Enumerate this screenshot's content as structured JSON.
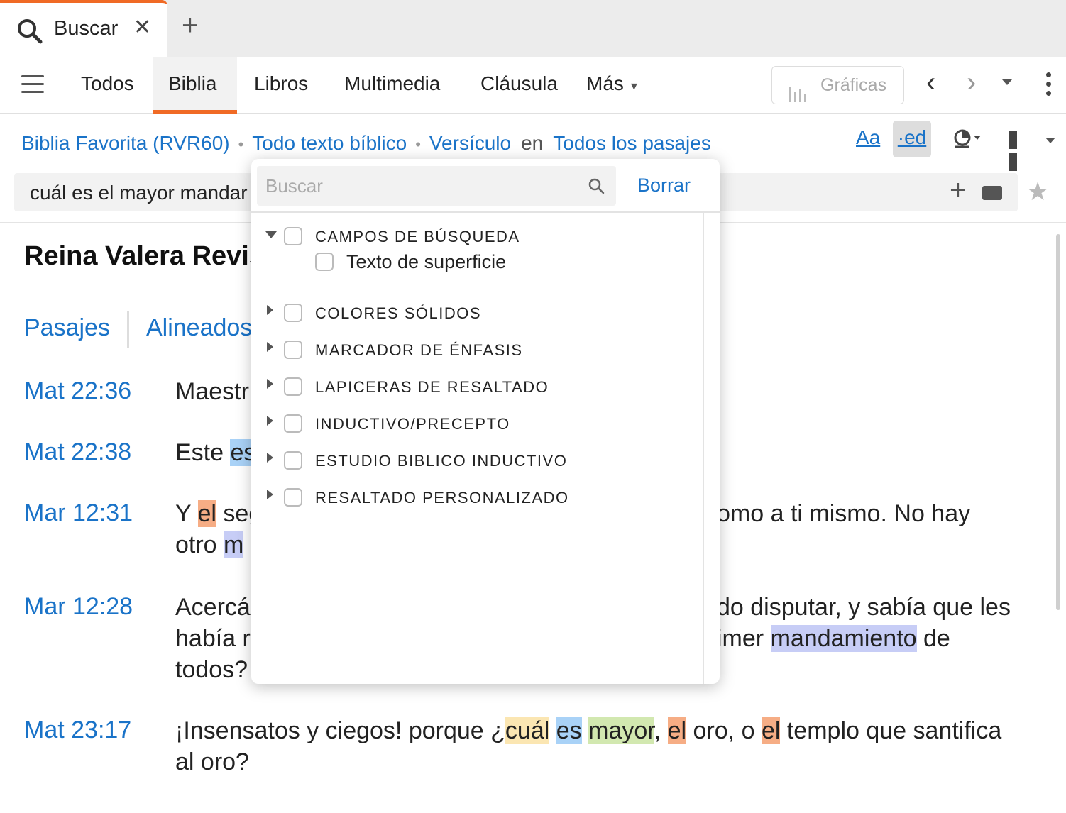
{
  "tab": {
    "title": "Buscar"
  },
  "nav": {
    "tabs": [
      "Todos",
      "Biblia",
      "Libros",
      "Multimedia",
      "Cláusula",
      "Más"
    ],
    "active_tab": "Biblia",
    "charts_label": "Gráficas"
  },
  "criteria": {
    "bible": "Biblia Favorita (RVR60)",
    "text": "Todo texto bíblico",
    "unit": "Versículo",
    "connector": "en",
    "range": "Todos los pasajes",
    "format_aa": "Aa",
    "format_ed": "·ed"
  },
  "search": {
    "query": "cuál es el mayor mandar"
  },
  "results": {
    "title": "Reina Valera Revis",
    "view_tabs": [
      "Pasajes",
      "Alineados"
    ],
    "verses": [
      {
        "ref": "Mat 22:36",
        "line1": "Maestr",
        "line2": ""
      },
      {
        "ref": "Mat 22:38",
        "pre": "Este ",
        "hl": "es"
      },
      {
        "ref": "Mar 12:31",
        "pre": "Y ",
        "hl": "el",
        "post": " seg",
        "right": "omo a ti mismo. No hay",
        "line2_pre": "otro ",
        "line2_hl": "m"
      },
      {
        "ref": "Mar 12:28",
        "pre": "Acercá",
        "right": "do disputar, y sabía que les",
        "line2_pre": "había r",
        "line2_right_pre": "imer ",
        "line2_right_hl": "mandamiento",
        "line2_right_post": " de",
        "line3": "todos?"
      },
      {
        "ref": "Mat 23:17",
        "t1": "¡Insensatos y ciegos! porque ¿",
        "h1": "cuál",
        "h2": "es",
        "h3": "mayor",
        "t2": ", ",
        "h4": "el",
        "t3": " oro, o ",
        "h5": "el",
        "t4": " templo que santifica",
        "line2": "al oro?"
      }
    ]
  },
  "popup": {
    "search_placeholder": "Buscar",
    "clear_label": "Borrar",
    "groups": [
      {
        "label": "CAMPOS DE BÚSQUEDA",
        "expanded": true,
        "children": [
          "Texto de superficie"
        ]
      },
      {
        "label": "COLORES SÓLIDOS",
        "expanded": false
      },
      {
        "label": "MARCADOR DE ÉNFASIS",
        "expanded": false
      },
      {
        "label": "LAPICERAS DE RESALTADO",
        "expanded": false
      },
      {
        "label": "INDUCTIVO/PRECEPTO",
        "expanded": false
      },
      {
        "label": "ESTUDIO BIBLICO INDUCTIVO",
        "expanded": false
      },
      {
        "label": "RESALTADO PERSONALIZADO",
        "expanded": false
      }
    ]
  },
  "colors": {
    "accent": "#f06a25",
    "link": "#1a73c8"
  }
}
